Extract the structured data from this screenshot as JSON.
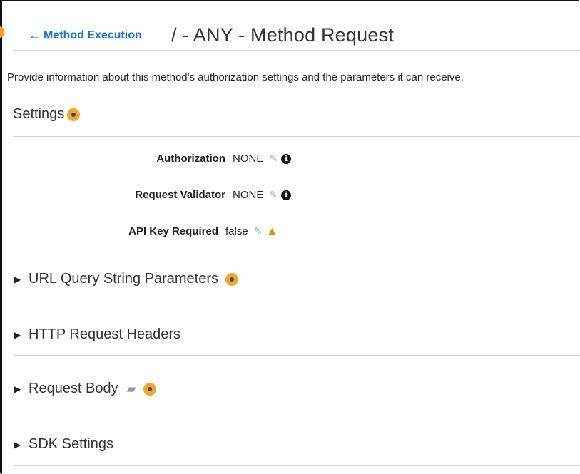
{
  "header": {
    "back_label": "Method Execution",
    "title": "/ - ANY - Method Request"
  },
  "description": "Provide information about this method's authorization settings and the parameters it can receive.",
  "settings": {
    "title": "Settings",
    "rows": [
      {
        "label": "Authorization",
        "value": "NONE",
        "trailing_icon": "info"
      },
      {
        "label": "Request Validator",
        "value": "NONE",
        "trailing_icon": "info"
      },
      {
        "label": "API Key Required",
        "value": "false",
        "trailing_icon": "warning"
      }
    ]
  },
  "sections": [
    {
      "label": "URL Query String Parameters",
      "has_info": true,
      "has_book": false
    },
    {
      "label": "HTTP Request Headers",
      "has_info": false,
      "has_book": false
    },
    {
      "label": "Request Body",
      "has_info": true,
      "has_book": true
    },
    {
      "label": "SDK Settings",
      "has_info": false,
      "has_book": false
    }
  ],
  "colors": {
    "link": "#1a73c8",
    "info_dot": "#f5a623",
    "warning": "#f08c00"
  }
}
